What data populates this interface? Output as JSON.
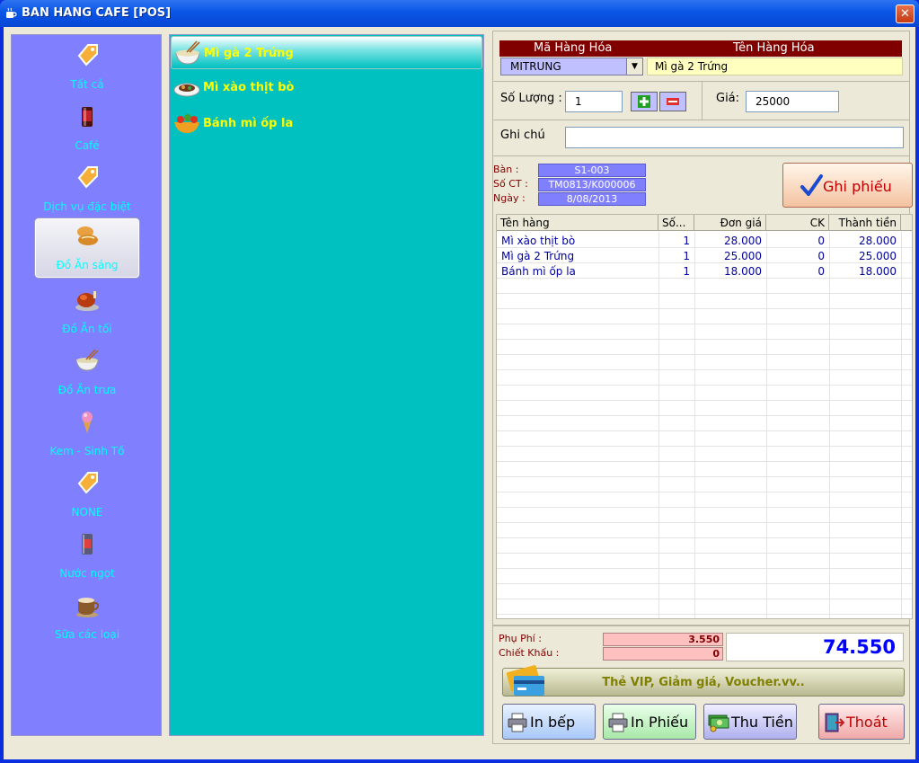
{
  "window": {
    "title": "BAN HANG CAFE [POS]",
    "close_glyph": "✕"
  },
  "categories": [
    {
      "label": "Tất cả",
      "icon": "tag-icon"
    },
    {
      "label": "Café",
      "icon": "drink-glass-icon"
    },
    {
      "label": "Dịch vụ đặc biệt",
      "icon": "tag-icon"
    },
    {
      "label": "Đồ Ăn sáng",
      "icon": "bread-icon",
      "active": true
    },
    {
      "label": "Đồ Ăn tối",
      "icon": "roast-chicken-icon"
    },
    {
      "label": "Đồ Ăn trưa",
      "icon": "noodle-bowl-icon"
    },
    {
      "label": "Kem - Sinh Tố",
      "icon": "ice-cream-icon"
    },
    {
      "label": "NONE",
      "icon": "tag-icon"
    },
    {
      "label": "Nước ngọt",
      "icon": "soda-can-icon"
    },
    {
      "label": "Sữa các loại",
      "icon": "coffee-cup-icon"
    }
  ],
  "menu_items": [
    {
      "label": "Mì gà 2 Trứng",
      "icon": "noodle-bowl-icon",
      "active": true
    },
    {
      "label": "Mì xào thịt bò",
      "icon": "stir-fry-plate-icon"
    },
    {
      "label": "Bánh mì ốp la",
      "icon": "salad-bowl-icon"
    }
  ],
  "product": {
    "code_header": "Mã Hàng Hóa",
    "name_header": "Tên Hàng Hóa",
    "code_value": "MITRUNG",
    "name_value": "Mì gà 2 Trứng"
  },
  "quantity": {
    "label": "Số Lượng :",
    "value": "1"
  },
  "price": {
    "label": "Giá:",
    "value": "25000"
  },
  "note": {
    "label": "Ghi chú",
    "value": ""
  },
  "ticket": {
    "table_label": "Bàn :",
    "table_value": "S1-003",
    "doc_label": "Số CT :",
    "doc_value": "TM0813/K000006",
    "date_label": "Ngày :",
    "date_value": "8/08/2013"
  },
  "ghi_phieu": {
    "label": "Ghi phiếu"
  },
  "grid": {
    "headers": [
      "Tên hàng",
      "Số...",
      "Đơn giá",
      "CK",
      "Thành tiền"
    ],
    "rows": [
      [
        "Mì xào thịt bò",
        "1",
        "28.000",
        "0",
        "28.000"
      ],
      [
        "Mì gà 2 Trứng",
        "1",
        "25.000",
        "0",
        "25.000"
      ],
      [
        "Bánh mì ốp la",
        "1",
        "18.000",
        "0",
        "18.000"
      ]
    ]
  },
  "totals": {
    "fee_label": "Phụ Phí :",
    "fee_value": "3.550",
    "discount_label": "Chiết Khấu :",
    "discount_value": "0",
    "grand_total": "74.550"
  },
  "vip": {
    "label": "Thẻ VIP, Giảm giá, Voucher.vv.."
  },
  "actions": [
    {
      "label": "In bếp",
      "icon": "printer-icon",
      "color": "#c0d8ff"
    },
    {
      "label": "In Phiếu",
      "icon": "printer-icon",
      "color": "#c0ffc0"
    },
    {
      "label": "Thu Tiền",
      "icon": "cash-icon",
      "color": "#c0c0ff"
    },
    {
      "label": "Thoát",
      "icon": "exit-door-icon",
      "color": "#ffc0c0"
    }
  ]
}
